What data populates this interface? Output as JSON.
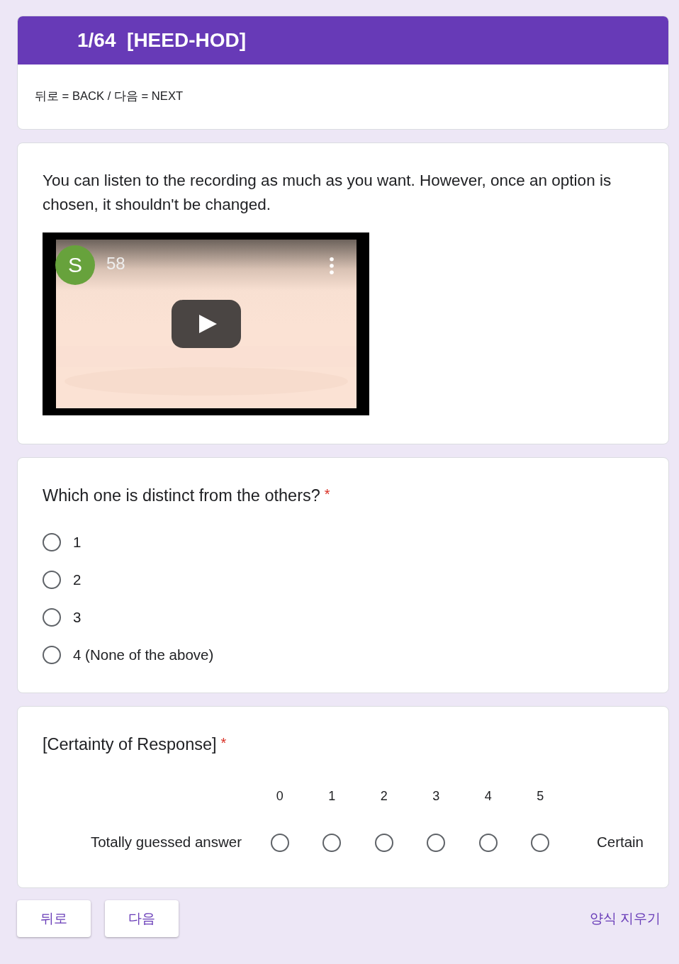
{
  "header": {
    "title": "1/64  [HEED-HOD]",
    "description": "뒤로 = BACK / 다음 = NEXT"
  },
  "media": {
    "instruction": "You can listen to the recording as much as you want. However, once an option is chosen, it shouldn't be changed.",
    "video": {
      "kind": "picture",
      "channel_initial": "S",
      "video_title": "58"
    }
  },
  "question": {
    "title": "Which one is distinct from the others?",
    "required_mark": "*",
    "options": [
      {
        "label": "1",
        "selected": false
      },
      {
        "label": "2",
        "selected": false
      },
      {
        "label": "3",
        "selected": false
      },
      {
        "label": "4 (None of the above)",
        "selected": false
      }
    ]
  },
  "scale": {
    "title": "[Certainty of Response]",
    "required_mark": "*",
    "low_label": "Totally guessed answer",
    "high_label": "Certain",
    "points": [
      {
        "label": "0",
        "selected": false
      },
      {
        "label": "1",
        "selected": false
      },
      {
        "label": "2",
        "selected": false
      },
      {
        "label": "3",
        "selected": false
      },
      {
        "label": "4",
        "selected": false
      },
      {
        "label": "5",
        "selected": false
      }
    ]
  },
  "footer": {
    "buttons": [
      "뒤로",
      "다음"
    ],
    "clear_link": "양식 지우기"
  }
}
